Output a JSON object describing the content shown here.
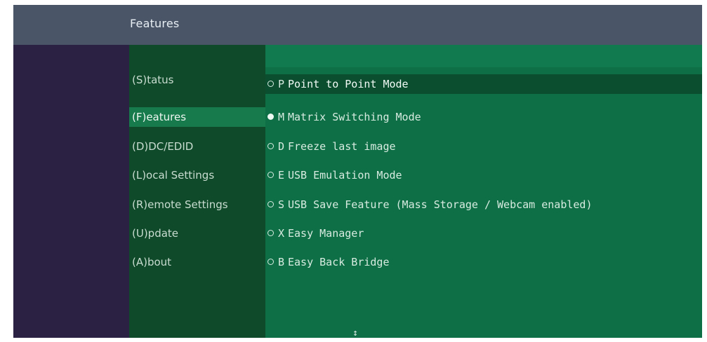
{
  "header": {
    "title": "Features"
  },
  "sidebar": {
    "items": [
      {
        "label": "(S)tatus",
        "active": false
      },
      {
        "label": "(F)eatures",
        "active": true
      },
      {
        "label": "(D)DC/EDID",
        "active": false
      },
      {
        "label": "(L)ocal  Settings",
        "active": false
      },
      {
        "label": "(R)emote Settings",
        "active": false
      },
      {
        "label": "(U)pdate",
        "active": false
      },
      {
        "label": "(A)bout",
        "active": false
      }
    ]
  },
  "options": [
    {
      "key": "P",
      "label": "Point to Point Mode",
      "selected": false,
      "highlighted": true
    },
    {
      "key": "M",
      "label": "Matrix Switching Mode",
      "selected": true,
      "highlighted": false
    },
    {
      "key": "D",
      "label": "Freeze last image",
      "selected": false,
      "highlighted": false
    },
    {
      "key": "E",
      "label": "USB Emulation Mode",
      "selected": false,
      "highlighted": false
    },
    {
      "key": "S",
      "label": "USB Save Feature (Mass Storage / Webcam enabled)",
      "selected": false,
      "highlighted": false
    },
    {
      "key": "X",
      "label": "Easy Manager",
      "selected": false,
      "highlighted": false
    },
    {
      "key": "B",
      "label": "Easy Back Bridge",
      "selected": false,
      "highlighted": false
    }
  ],
  "footer": {
    "scroll_marker": "↕"
  },
  "colors": {
    "title_bar": "#4a5668",
    "frame": "#2b2142",
    "sidebar": "#0f4a2a",
    "sidebar_active": "#167a4d",
    "main": "#0e6f46",
    "row_highlight": "#0a4d2f"
  }
}
